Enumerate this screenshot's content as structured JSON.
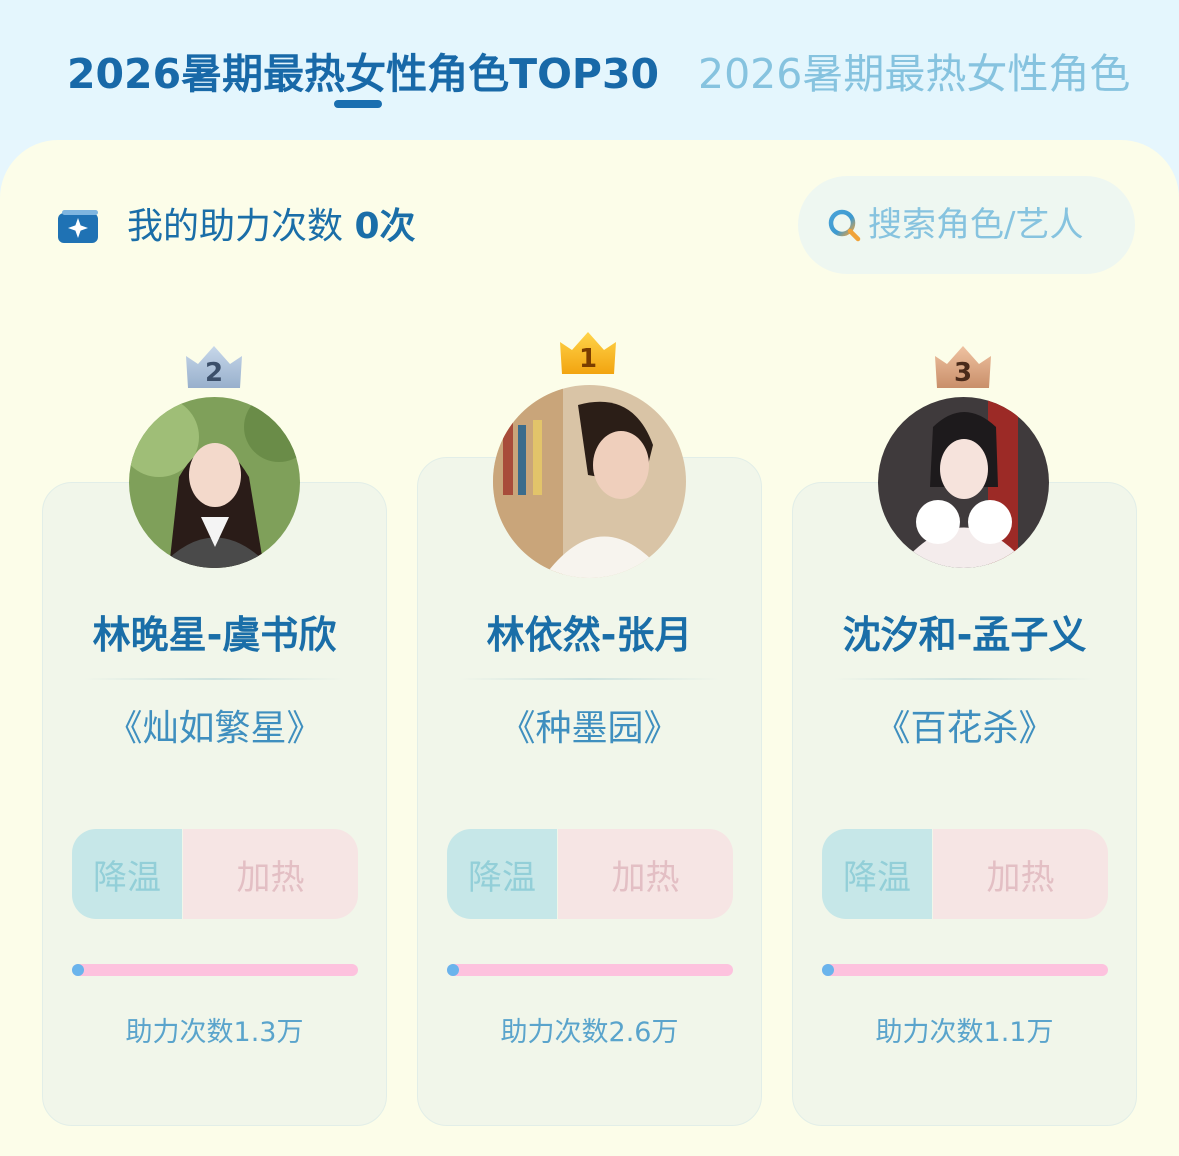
{
  "tabs": [
    {
      "label": "2026暑期最热女性角色TOP30",
      "active": true
    },
    {
      "label": "2026暑期最热女性角色",
      "active": false
    }
  ],
  "boost": {
    "label": "我的助力次数 ",
    "count": "0次"
  },
  "search": {
    "placeholder": "搜索角色/艺人"
  },
  "buttons": {
    "cool": "降温",
    "heat": "加热"
  },
  "cards": [
    {
      "rank": 2,
      "rank_label": "2",
      "name": "林晚星-虞书欣",
      "work": "《灿如繁星》",
      "boost_text": "助力次数1.3万",
      "progress": 0.02
    },
    {
      "rank": 1,
      "rank_label": "1",
      "name": "林依然-张月",
      "work": "《种墨园》",
      "boost_text": "助力次数2.6万",
      "progress": 0.02
    },
    {
      "rank": 3,
      "rank_label": "3",
      "name": "沈汐和-孟子义",
      "work": "《百花杀》",
      "boost_text": "助力次数1.1万",
      "progress": 0.02
    }
  ],
  "colors": {
    "primary": "#1a6ea8",
    "crown_gold": "#f6b51c",
    "crown_silver": "#a9bfd8",
    "crown_bronze": "#d9a887"
  }
}
